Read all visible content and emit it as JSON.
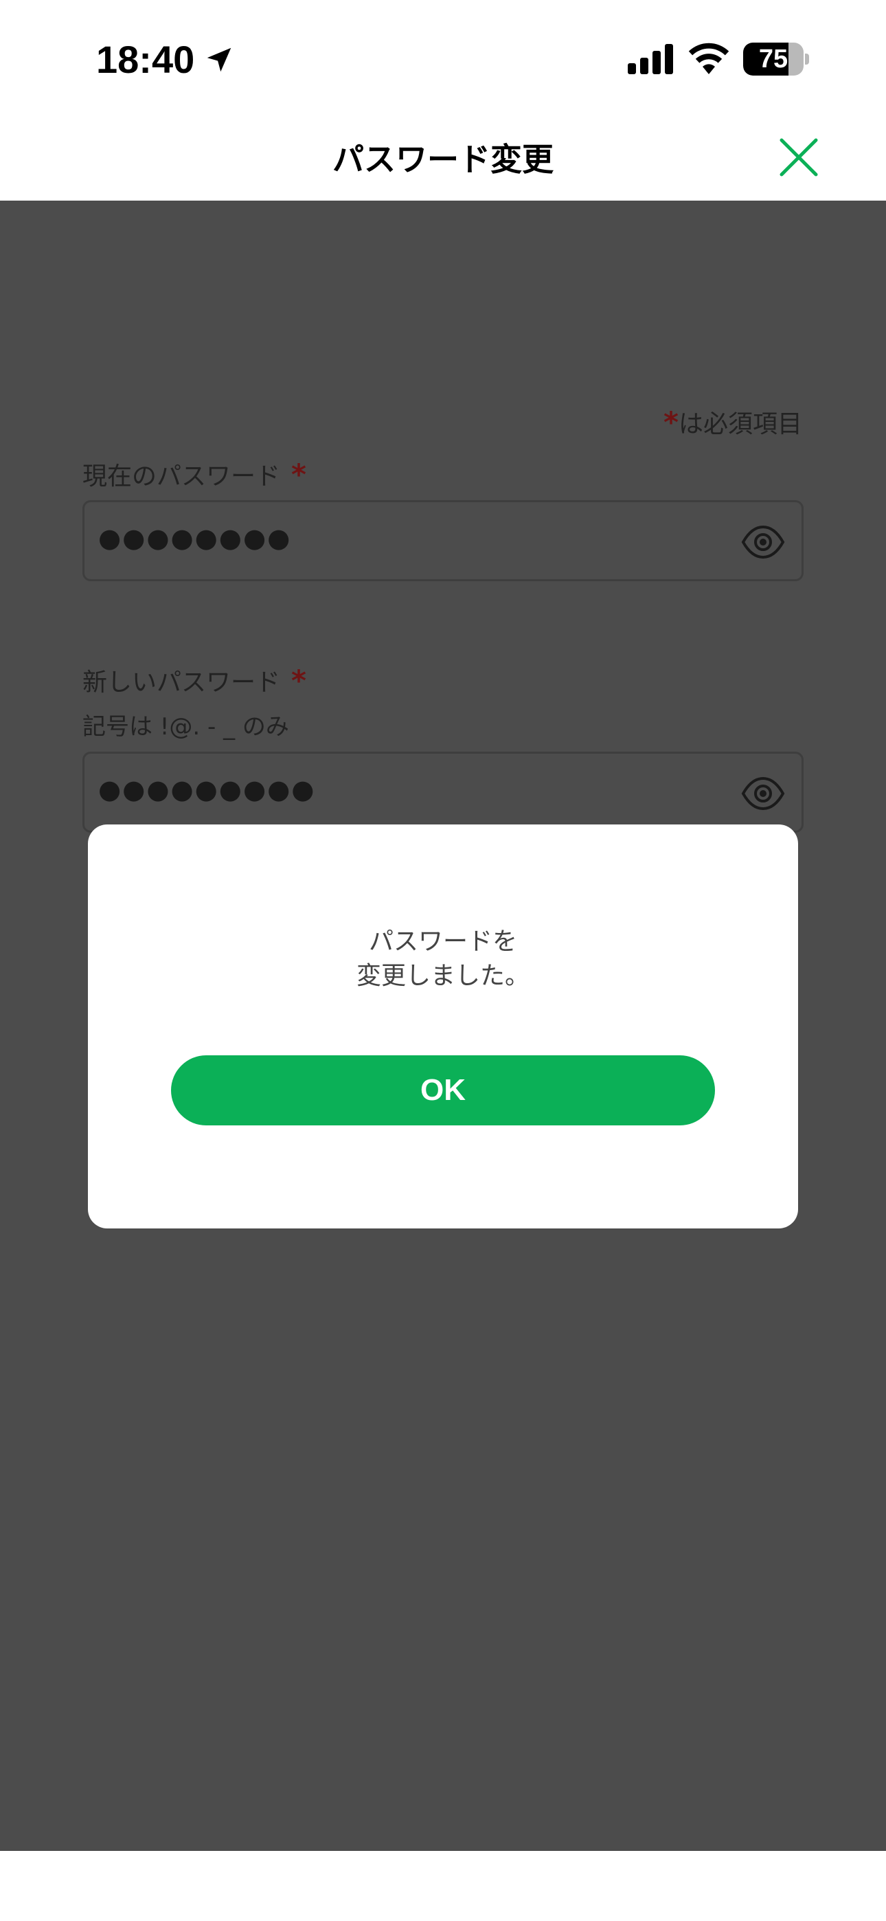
{
  "status_bar": {
    "time": "18:40",
    "battery_level": "75",
    "battery_fraction": 0.75,
    "icons": [
      "location-arrow-icon",
      "cellular-signal-icon",
      "wifi-icon",
      "battery-icon"
    ]
  },
  "header": {
    "title": "パスワード変更",
    "close_icon": "close-icon",
    "accent_color": "#0bb057"
  },
  "form": {
    "required_marker": "*",
    "required_note": "は必須項目",
    "current_password": {
      "label": "現在のパスワード",
      "value": "●●●●●●●●",
      "toggle_icon": "eye-icon"
    },
    "new_password": {
      "label": "新しいパスワード",
      "hint": "記号は !@. - _ のみ",
      "value": "●●●●●●●●●",
      "toggle_icon": "eye-icon"
    }
  },
  "dialog": {
    "message_line1": "パスワードを",
    "message_line2": "変更しました。",
    "ok_label": "OK"
  },
  "colors": {
    "overlay": "#4c4c4c",
    "required_star": "#6e1414",
    "primary_button": "#0bb057"
  }
}
